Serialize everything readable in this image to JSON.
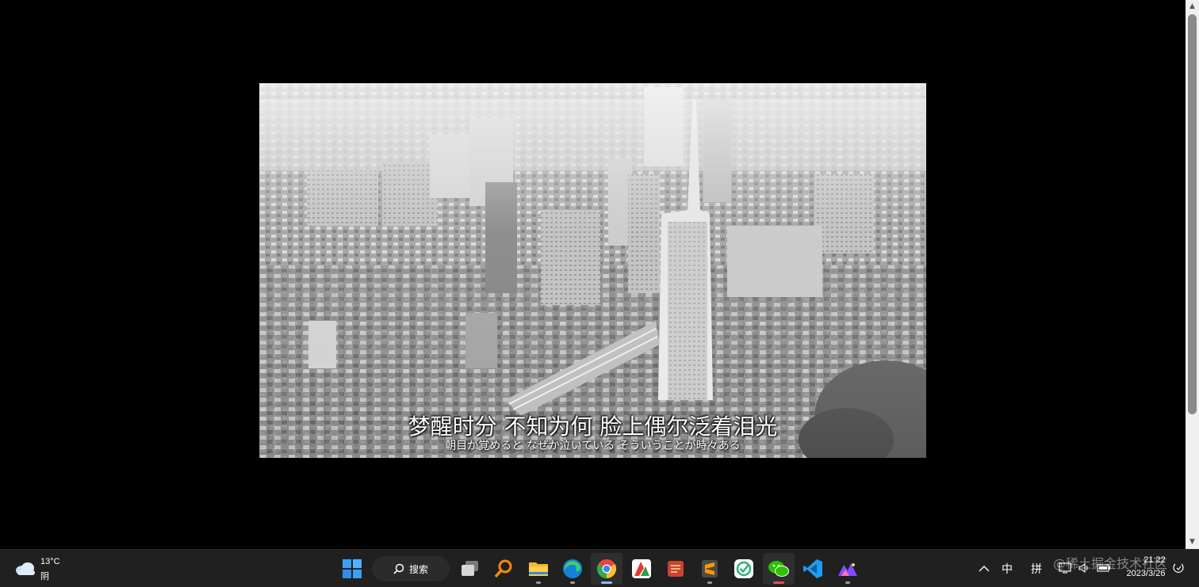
{
  "video": {
    "subtitle_main": "梦醒时分 不知为何 脸上偶尔泛着泪光",
    "subtitle_japanese": "朝目が覚めると なぜか泣いている そういうことが時々ある"
  },
  "taskbar": {
    "weather": {
      "temperature": "13°C",
      "condition": "阴",
      "icon": "cloud-icon"
    },
    "search_label": "搜索",
    "apps": [
      {
        "name": "start-icon"
      },
      {
        "name": "task-view-icon"
      },
      {
        "name": "search-tool-icon"
      },
      {
        "name": "file-explorer-icon"
      },
      {
        "name": "edge-icon"
      },
      {
        "name": "chrome-icon"
      },
      {
        "name": "app-red-green-icon"
      },
      {
        "name": "app-orange-icon"
      },
      {
        "name": "sublime-text-icon"
      },
      {
        "name": "tick-task-icon"
      },
      {
        "name": "wechat-icon"
      },
      {
        "name": "vscode-icon"
      },
      {
        "name": "purple-app-icon"
      }
    ],
    "ime_mode": "中",
    "ime_pinyin": "拼",
    "clock_time": "21:22",
    "clock_date": "2023/3/26",
    "watermark": "@稀土掘金技术社区"
  },
  "colors": {
    "taskbar_bg": "#202020",
    "accent": "#7dc3f0"
  }
}
